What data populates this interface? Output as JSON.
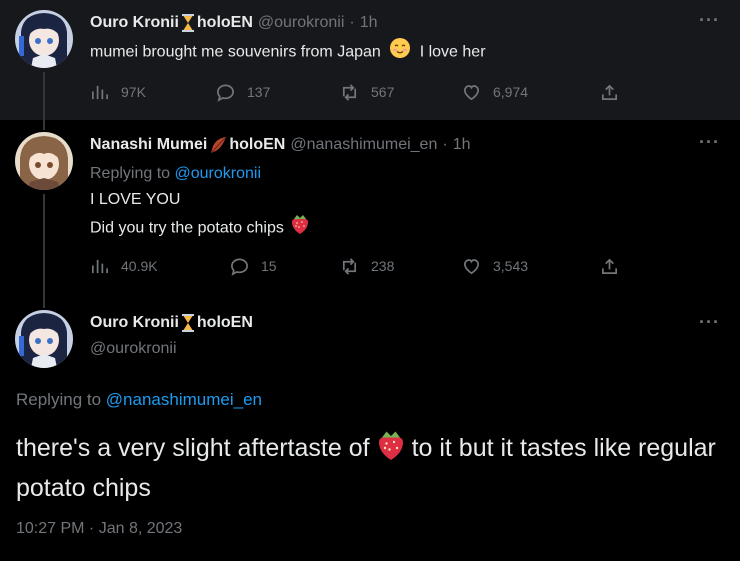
{
  "tweets": [
    {
      "name": "Ouro Kronii",
      "org": "holoEN",
      "handle": "@ourokronii",
      "time": "1h",
      "text": "mumei brought me souvenirs from Japan",
      "text_after": "I love her",
      "stats": {
        "views": "97K",
        "replies": "137",
        "retweets": "567",
        "likes": "6,974"
      }
    },
    {
      "name": "Nanashi Mumei",
      "org": "holoEN",
      "handle": "@nanashimumei_en",
      "time": "1h",
      "replying_label": "Replying to",
      "replying_to": "@ourokronii",
      "line1": "I LOVE YOU",
      "line2": "Did you try the potato chips",
      "stats": {
        "views": "40.9K",
        "replies": "15",
        "retweets": "238",
        "likes": "3,543"
      }
    },
    {
      "name": "Ouro Kronii",
      "org": "holoEN",
      "handle": "@ourokronii",
      "replying_label": "Replying to",
      "replying_to": "@nanashimumei_en",
      "text_before": "there's a very slight aftertaste of",
      "text_after": "to it but it tastes like regular potato chips",
      "timestamp": "10:27 PM · Jan 8, 2023"
    }
  ],
  "dot_separator": "·",
  "more_glyph": "···",
  "colors": {
    "accent": "#1d9bf0",
    "muted": "#71767b",
    "background": "#000000",
    "highlight_bg": "#16181c"
  },
  "icons": [
    "views-icon",
    "reply-icon",
    "retweet-icon",
    "like-icon",
    "share-icon",
    "hourglass-icon",
    "feather-icon",
    "strawberry-icon",
    "smiling-face-icon"
  ]
}
